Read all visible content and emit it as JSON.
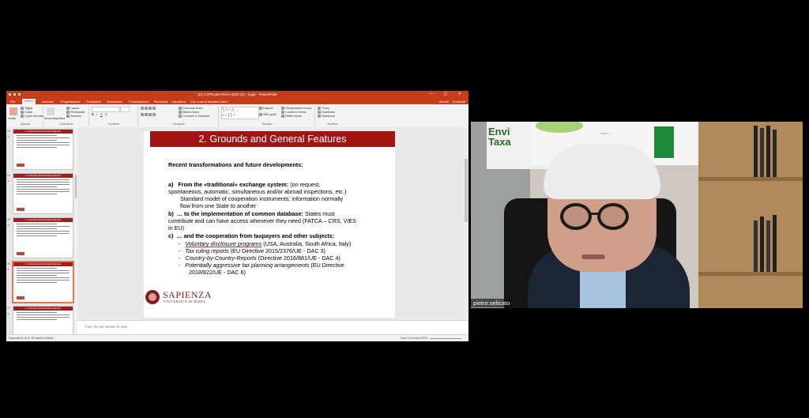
{
  "window": {
    "title": "(C) CAPS pre-ITA/AI 2022 (1) - 4.ppt - PowerPoint",
    "controls": "— ▢ ✕"
  },
  "ribbon": {
    "tabs": [
      "File",
      "Home",
      "Inserisci",
      "Progettazione",
      "Transizioni",
      "Animazioni",
      "Presentazione",
      "Revisione",
      "Visualizza",
      "Che cosa si desidera fare?"
    ],
    "active_tab": "Home",
    "account": [
      "Accedi",
      "Condividi"
    ],
    "clipboard": {
      "paste": "Incolla",
      "cut": "Taglia",
      "copy": "Copia",
      "format_painter": "Copia formato",
      "label": "Appunti"
    },
    "slides": {
      "new_slide": "Nuova diapositiva",
      "layout": "Layout",
      "reset": "Reimposta",
      "section": "Sezione",
      "label": "Diapositive"
    },
    "font": {
      "label": "Carattere"
    },
    "paragraph": {
      "direction": "Direzione testo",
      "align": "Allinea testo",
      "smartart": "Converti in SmartArt",
      "label": "Paragrafo"
    },
    "drawing": {
      "arrange": "Disponi",
      "quick_styles": "Stili rapidi",
      "fill": "Riempimento forma",
      "outline": "Contorno forma",
      "effects": "Effetti forma",
      "label": "Disegno"
    },
    "editing": {
      "find": "Trova",
      "replace": "Sostituisci",
      "select": "Seleziona",
      "label": "Modifica"
    }
  },
  "thumbnails": [
    {
      "num": "13",
      "title": "2. Grounds and General Features"
    },
    {
      "num": "14",
      "title": "2. Grounds and General Features"
    },
    {
      "num": "15",
      "title": "2. Grounds and General Features"
    },
    {
      "num": "16",
      "title": "2. Grounds and General Features",
      "selected": true
    },
    {
      "num": "17",
      "title": "2. Grounds and General Features"
    }
  ],
  "slide": {
    "title": "2. Grounds and General Features",
    "heading": "Recent transformations and future developments:",
    "a_label": "a)",
    "a_bold": "From the «traditional» exchange system:",
    "a_rest": "(on request,",
    "a_line2": "spontaneous, automatic, simultaneous and/or abroad inspections, etc.)",
    "a_line3": "Standard model of cooperation instruments: information normally",
    "a_line4": "flow from one State to another",
    "b_label": "b)",
    "b_bold": "… to the implementation of common database:",
    "b_rest": "States must",
    "b_line2": "contribute and can have access whenever they need (FATCA – CRS, VIES",
    "b_line3": "in EU)",
    "c_label": "c)",
    "c_bold": "… and the cooperation from taxpayers and other subjects:",
    "bullets": [
      {
        "dash": "-",
        "italic": "Voluntary disclosure programs",
        "rest": " (USA, Australia, South Africa, Italy)"
      },
      {
        "dash": "-",
        "italic": "Tax ruling reports",
        "rest": " (EU Directive 2015/2376/UE - DAC 3)"
      },
      {
        "dash": "-",
        "italic": "Country-by-Country-Reports",
        "rest": " (Directive 2016/881/UE - DAC 4)"
      },
      {
        "dash": "-",
        "italic": "Potentially aggressive tax planning arrangements",
        "rest": " (EU Directive"
      }
    ],
    "bullet_cont": "2018/822/UE - DAC 6)",
    "logo_name": "SAPIENZA",
    "logo_sub": "UNIVERSITÀ DI ROMA"
  },
  "notes_placeholder": "Fare clic per inserire le note",
  "status": {
    "left": "Diapositiva 16 di 36   Italiano (Italia)",
    "right": "Note   Commenti   92%"
  },
  "webcam": {
    "participant_name": "pietro.selicato",
    "poster_text_1": "Envi",
    "poster_text_2": "Taxa"
  }
}
